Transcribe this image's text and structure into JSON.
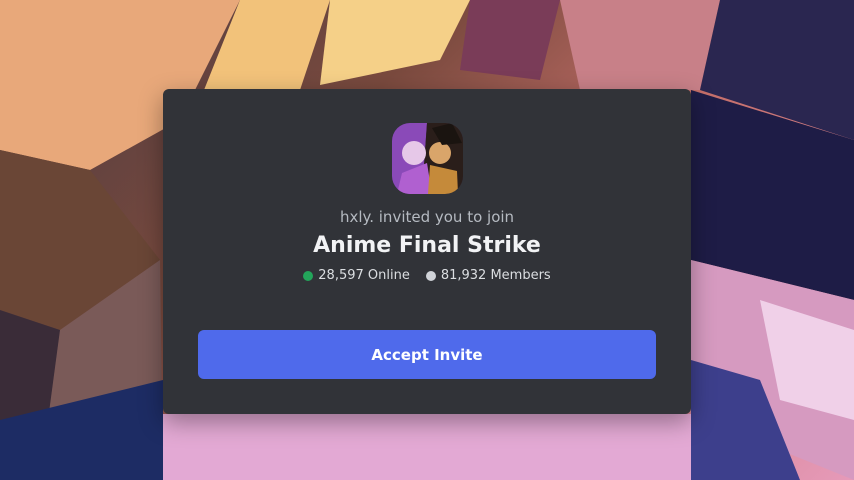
{
  "invite": {
    "inviter_text": "hxly. invited you to join",
    "server_name": "Anime Final Strike",
    "online_count": "28,597 Online",
    "member_count": "81,932 Members",
    "accept_label": "Accept Invite",
    "server_icon": "server-avatar-icon"
  },
  "colors": {
    "modal_bg": "#313338",
    "button_bg": "#4f6aeb",
    "online_dot": "#23a55a",
    "members_dot": "#d0d3d8"
  }
}
